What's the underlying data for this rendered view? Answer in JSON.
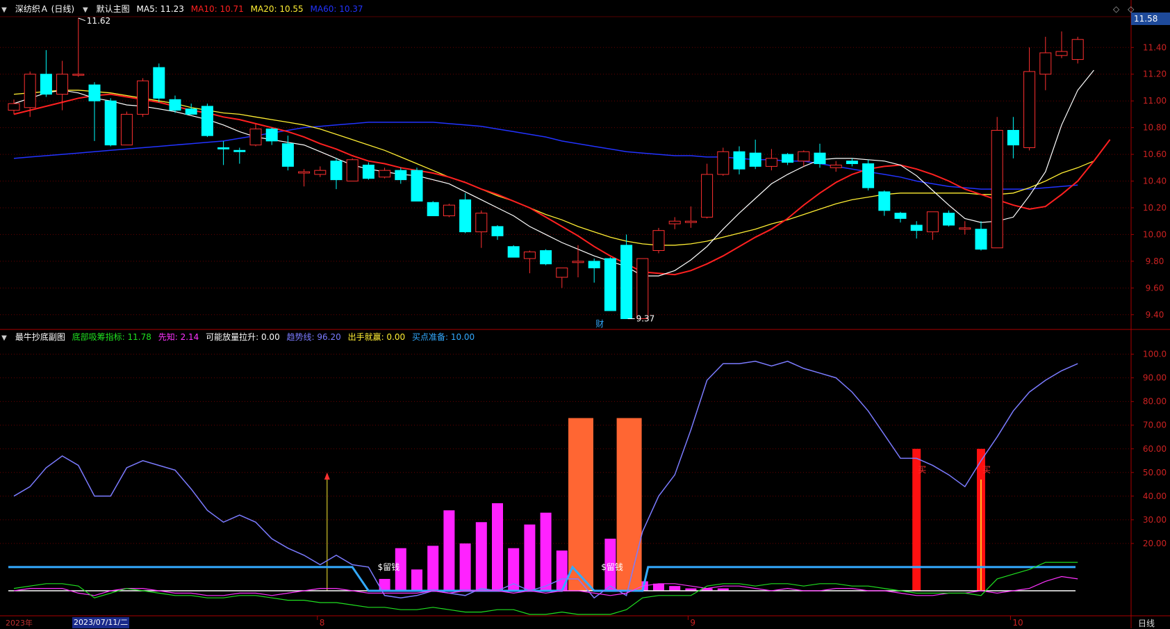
{
  "main_panel": {
    "stock_name": "深纺织Ａ (日线)",
    "template_name": "默认主图",
    "ma5": {
      "label": "MA5: 11.23",
      "color": "#ffffff"
    },
    "ma10": {
      "label": "MA10: 10.71",
      "color": "#ff2020"
    },
    "ma20": {
      "label": "MA20: 10.55",
      "color": "#ffee33"
    },
    "ma60": {
      "label": "MA60: 10.37",
      "color": "#2233ff"
    },
    "last_price_badge": "11.58",
    "high_label": "11.62",
    "low_label": "9.37",
    "event_marker": "财",
    "price_axis": [
      "11.40",
      "11.20",
      "11.00",
      "10.80",
      "10.60",
      "10.40",
      "10.20",
      "10.00",
      "9.80",
      "9.60",
      "9.40"
    ],
    "price_range": [
      9.3,
      11.62
    ]
  },
  "sub_panel": {
    "title": "最牛抄底副图",
    "indicators": [
      {
        "label": "底部吸筹指标: 11.78",
        "color": "#20e020"
      },
      {
        "label": "先知: 2.14",
        "color": "#ff33ff"
      },
      {
        "label": "可能放量拉升: 0.00",
        "color": "#ffffff"
      },
      {
        "label": "趋势线: 96.20",
        "color": "#7b7bff"
      },
      {
        "label": "出手就赢: 0.00",
        "color": "#ffee33"
      },
      {
        "label": "买点准备: 10.00",
        "color": "#33aaff"
      }
    ],
    "axis": [
      "100.0",
      "90.00",
      "80.00",
      "70.00",
      "60.00",
      "50.00",
      "40.00",
      "30.00",
      "20.00"
    ],
    "range": [
      -10,
      104
    ],
    "annotations": [
      "$留钱",
      "$留钱",
      "买",
      "买"
    ]
  },
  "time_axis": {
    "year_label": "2023年",
    "cursor_date": "2023/07/11/二",
    "month_labels": [
      "8",
      "9",
      "10"
    ],
    "period": "日线"
  },
  "colors": {
    "up": "#ff3030",
    "down": "#00ffff",
    "grid": "#6a0000",
    "axis_text": "#cc2222"
  },
  "candles": [
    [
      10.93,
      10.98,
      10.9,
      11.01
    ],
    [
      10.95,
      11.2,
      10.88,
      11.22
    ],
    [
      11.2,
      11.05,
      11.03,
      11.38
    ],
    [
      11.05,
      11.2,
      10.93,
      11.3
    ],
    [
      11.2,
      11.2,
      11.18,
      11.62
    ],
    [
      11.12,
      11.0,
      10.7,
      11.14
    ],
    [
      11.0,
      10.67,
      10.66,
      11.02
    ],
    [
      10.67,
      10.9,
      10.67,
      10.92
    ],
    [
      10.9,
      11.15,
      10.88,
      11.17
    ],
    [
      11.25,
      11.02,
      10.99,
      11.28
    ],
    [
      11.01,
      10.93,
      10.91,
      11.04
    ],
    [
      10.94,
      10.9,
      10.9,
      10.98
    ],
    [
      10.96,
      10.74,
      10.73,
      10.98
    ],
    [
      10.65,
      10.64,
      10.52,
      10.7
    ],
    [
      10.63,
      10.62,
      10.53,
      10.65
    ],
    [
      10.67,
      10.79,
      10.66,
      10.83
    ],
    [
      10.79,
      10.7,
      10.67,
      10.8
    ],
    [
      10.68,
      10.51,
      10.48,
      10.74
    ],
    [
      10.46,
      10.47,
      10.36,
      10.49
    ],
    [
      10.45,
      10.48,
      10.43,
      10.51
    ],
    [
      10.55,
      10.41,
      10.34,
      10.57
    ],
    [
      10.4,
      10.56,
      10.4,
      10.57
    ],
    [
      10.52,
      10.42,
      10.41,
      10.54
    ],
    [
      10.43,
      10.48,
      10.42,
      10.5
    ],
    [
      10.48,
      10.41,
      10.38,
      10.5
    ],
    [
      10.48,
      10.25,
      10.25,
      10.5
    ],
    [
      10.24,
      10.14,
      10.14,
      10.25
    ],
    [
      10.14,
      10.22,
      10.13,
      10.23
    ],
    [
      10.26,
      10.02,
      10.01,
      10.31
    ],
    [
      10.02,
      10.16,
      9.9,
      10.18
    ],
    [
      10.06,
      9.99,
      9.96,
      10.07
    ],
    [
      9.91,
      9.83,
      9.83,
      9.92
    ],
    [
      9.82,
      9.87,
      9.71,
      9.88
    ],
    [
      9.88,
      9.78,
      9.77,
      9.89
    ],
    [
      9.68,
      9.75,
      9.6,
      9.75
    ],
    [
      9.79,
      9.8,
      9.68,
      9.92
    ],
    [
      9.8,
      9.75,
      9.64,
      9.82
    ],
    [
      9.82,
      9.43,
      9.43,
      9.83
    ],
    [
      9.92,
      9.37,
      9.37,
      10.0
    ],
    [
      9.37,
      9.82,
      9.37,
      9.82
    ],
    [
      9.88,
      10.03,
      9.86,
      10.05
    ],
    [
      10.08,
      10.1,
      10.04,
      10.13
    ],
    [
      10.09,
      10.1,
      10.05,
      10.21
    ],
    [
      10.13,
      10.45,
      10.12,
      10.53
    ],
    [
      10.45,
      10.62,
      10.44,
      10.65
    ],
    [
      10.62,
      10.49,
      10.45,
      10.66
    ],
    [
      10.61,
      10.51,
      10.49,
      10.71
    ],
    [
      10.51,
      10.57,
      10.48,
      10.64
    ],
    [
      10.6,
      10.54,
      10.52,
      10.61
    ],
    [
      10.55,
      10.62,
      10.51,
      10.63
    ],
    [
      10.61,
      10.53,
      10.5,
      10.68
    ],
    [
      10.5,
      10.52,
      10.47,
      10.55
    ],
    [
      10.55,
      10.53,
      10.51,
      10.57
    ],
    [
      10.53,
      10.35,
      10.33,
      10.56
    ],
    [
      10.32,
      10.18,
      10.14,
      10.33
    ],
    [
      10.16,
      10.12,
      10.09,
      10.17
    ],
    [
      10.07,
      10.03,
      9.97,
      10.1
    ],
    [
      10.02,
      10.17,
      9.96,
      10.17
    ],
    [
      10.16,
      10.07,
      10.06,
      10.18
    ],
    [
      10.04,
      10.05,
      10.0,
      10.1
    ],
    [
      10.04,
      9.89,
      9.88,
      10.1
    ],
    [
      9.9,
      10.78,
      9.9,
      10.88
    ],
    [
      10.78,
      10.67,
      10.57,
      10.88
    ],
    [
      10.65,
      11.22,
      10.63,
      11.4
    ],
    [
      11.2,
      11.36,
      11.08,
      11.48
    ],
    [
      11.34,
      11.37,
      11.32,
      11.52
    ],
    [
      11.31,
      11.46,
      11.28,
      11.48
    ]
  ],
  "ma5_values": [
    10.98,
    11.02,
    11.06,
    11.08,
    11.06,
    11.02,
    11.0,
    10.97,
    10.96,
    10.94,
    10.92,
    10.89,
    10.86,
    10.82,
    10.77,
    10.73,
    10.71,
    10.69,
    10.67,
    10.62,
    10.57,
    10.52,
    10.49,
    10.47,
    10.45,
    10.44,
    10.41,
    10.38,
    10.32,
    10.26,
    10.2,
    10.14,
    10.06,
    10.0,
    9.94,
    9.89,
    9.84,
    9.8,
    9.76,
    9.69,
    9.69,
    9.73,
    9.81,
    9.91,
    10.04,
    10.16,
    10.27,
    10.38,
    10.45,
    10.51,
    10.56,
    10.57,
    10.57,
    10.56,
    10.55,
    10.52,
    10.44,
    10.33,
    10.22,
    10.12,
    10.09,
    10.1,
    10.13,
    10.29,
    10.47,
    10.82,
    11.08,
    11.23
  ],
  "ma10_values": [
    10.9,
    10.93,
    10.96,
    10.99,
    11.02,
    11.04,
    11.05,
    11.03,
    11.01,
    10.99,
    10.96,
    10.93,
    10.91,
    10.88,
    10.86,
    10.83,
    10.8,
    10.77,
    10.73,
    10.68,
    10.64,
    10.59,
    10.55,
    10.53,
    10.5,
    10.48,
    10.46,
    10.43,
    10.39,
    10.34,
    10.3,
    10.25,
    10.2,
    10.13,
    10.06,
    9.99,
    9.91,
    9.84,
    9.78,
    9.72,
    9.71,
    9.7,
    9.73,
    9.78,
    9.84,
    9.91,
    9.98,
    10.04,
    10.12,
    10.22,
    10.31,
    10.39,
    10.45,
    10.49,
    10.51,
    10.52,
    10.49,
    10.45,
    10.4,
    10.34,
    10.3,
    10.26,
    10.22,
    10.19,
    10.21,
    10.3,
    10.4,
    10.55,
    10.71
  ],
  "ma20_values": [
    11.05,
    11.06,
    11.07,
    11.08,
    11.08,
    11.07,
    11.06,
    11.04,
    11.02,
    11.0,
    10.98,
    10.95,
    10.93,
    10.91,
    10.9,
    10.88,
    10.86,
    10.84,
    10.82,
    10.79,
    10.75,
    10.71,
    10.67,
    10.63,
    10.58,
    10.53,
    10.48,
    10.43,
    10.39,
    10.34,
    10.29,
    10.25,
    10.2,
    10.15,
    10.11,
    10.06,
    10.02,
    9.98,
    9.95,
    9.93,
    9.92,
    9.92,
    9.93,
    9.95,
    9.98,
    10.01,
    10.04,
    10.08,
    10.11,
    10.15,
    10.19,
    10.23,
    10.26,
    10.28,
    10.3,
    10.31,
    10.31,
    10.31,
    10.31,
    10.31,
    10.3,
    10.3,
    10.31,
    10.35,
    10.4,
    10.46,
    10.5,
    10.55
  ],
  "ma60_values": [
    10.57,
    10.58,
    10.59,
    10.6,
    10.61,
    10.62,
    10.63,
    10.64,
    10.65,
    10.66,
    10.67,
    10.68,
    10.69,
    10.7,
    10.72,
    10.74,
    10.76,
    10.78,
    10.8,
    10.81,
    10.82,
    10.83,
    10.84,
    10.84,
    10.84,
    10.84,
    10.84,
    10.83,
    10.82,
    10.81,
    10.79,
    10.77,
    10.75,
    10.73,
    10.7,
    10.68,
    10.66,
    10.64,
    10.62,
    10.61,
    10.6,
    10.59,
    10.59,
    10.58,
    10.58,
    10.57,
    10.56,
    10.56,
    10.55,
    10.55,
    10.53,
    10.51,
    10.49,
    10.47,
    10.45,
    10.43,
    10.4,
    10.38,
    10.36,
    10.35,
    10.34,
    10.34,
    10.34,
    10.34,
    10.35,
    10.36,
    10.37
  ],
  "trend_values": [
    40,
    44,
    52,
    57,
    53,
    40,
    40,
    52,
    55,
    53,
    51,
    43,
    34,
    29,
    32,
    29,
    22,
    18,
    15,
    11,
    15,
    11,
    10,
    -2,
    -3,
    -2,
    0,
    -1,
    -2,
    1,
    0,
    3,
    0,
    2,
    5,
    5,
    -3,
    2,
    -2,
    25,
    40,
    49,
    68,
    89,
    96,
    96,
    97,
    95,
    97,
    94,
    92,
    90,
    84,
    76,
    66,
    56,
    56,
    53,
    49,
    44,
    55,
    65,
    76,
    84,
    89,
    93,
    96
  ],
  "xianzhi_values": [
    0,
    1,
    1,
    1,
    -1,
    -2,
    0,
    1,
    1,
    0,
    -1,
    -1,
    -2,
    -2,
    -1,
    -1,
    -2,
    -1,
    0,
    1,
    1,
    0,
    -1,
    -1,
    -1,
    -1,
    0,
    -1,
    0,
    0,
    0,
    -1,
    0,
    -1,
    0,
    0,
    -1,
    -2,
    -1,
    2,
    3,
    3,
    2,
    1,
    2,
    2,
    1,
    0,
    1,
    0,
    0,
    1,
    1,
    0,
    0,
    -1,
    -2,
    -2,
    -1,
    -1,
    0,
    -1,
    0,
    1,
    4,
    6,
    5,
    3,
    2
  ],
  "xichou_values": [
    1,
    2,
    3,
    3,
    2,
    -3,
    -1,
    1,
    0,
    -1,
    -2,
    -2,
    -3,
    -3,
    -2,
    -2,
    -3,
    -4,
    -4,
    -5,
    -5,
    -6,
    -7,
    -7,
    -8,
    -8,
    -7,
    -8,
    -9,
    -9,
    -8,
    -8,
    -10,
    -10,
    -9,
    -10,
    -10,
    -10,
    -8,
    -3,
    -2,
    -2,
    -2,
    2,
    3,
    3,
    2,
    3,
    3,
    2,
    3,
    3,
    2,
    2,
    1,
    0,
    -1,
    -1,
    -1,
    -1,
    -2,
    5,
    7,
    9,
    12,
    12,
    12
  ],
  "magenta_bars": [
    [
      23,
      5
    ],
    [
      24,
      18
    ],
    [
      25,
      9
    ],
    [
      26,
      19
    ],
    [
      27,
      34
    ],
    [
      28,
      20
    ],
    [
      29,
      29
    ],
    [
      30,
      37
    ],
    [
      31,
      18
    ],
    [
      32,
      28
    ],
    [
      33,
      33
    ],
    [
      34,
      17
    ],
    [
      37,
      22
    ],
    [
      38,
      30
    ],
    [
      39,
      4
    ],
    [
      40,
      3
    ],
    [
      41,
      2
    ],
    [
      42,
      1
    ],
    [
      43,
      1
    ],
    [
      44,
      1
    ]
  ],
  "orange_bars": [
    [
      35,
      73
    ],
    [
      38,
      73
    ]
  ],
  "red_bars": [
    [
      56,
      60
    ],
    [
      60,
      60
    ]
  ]
}
